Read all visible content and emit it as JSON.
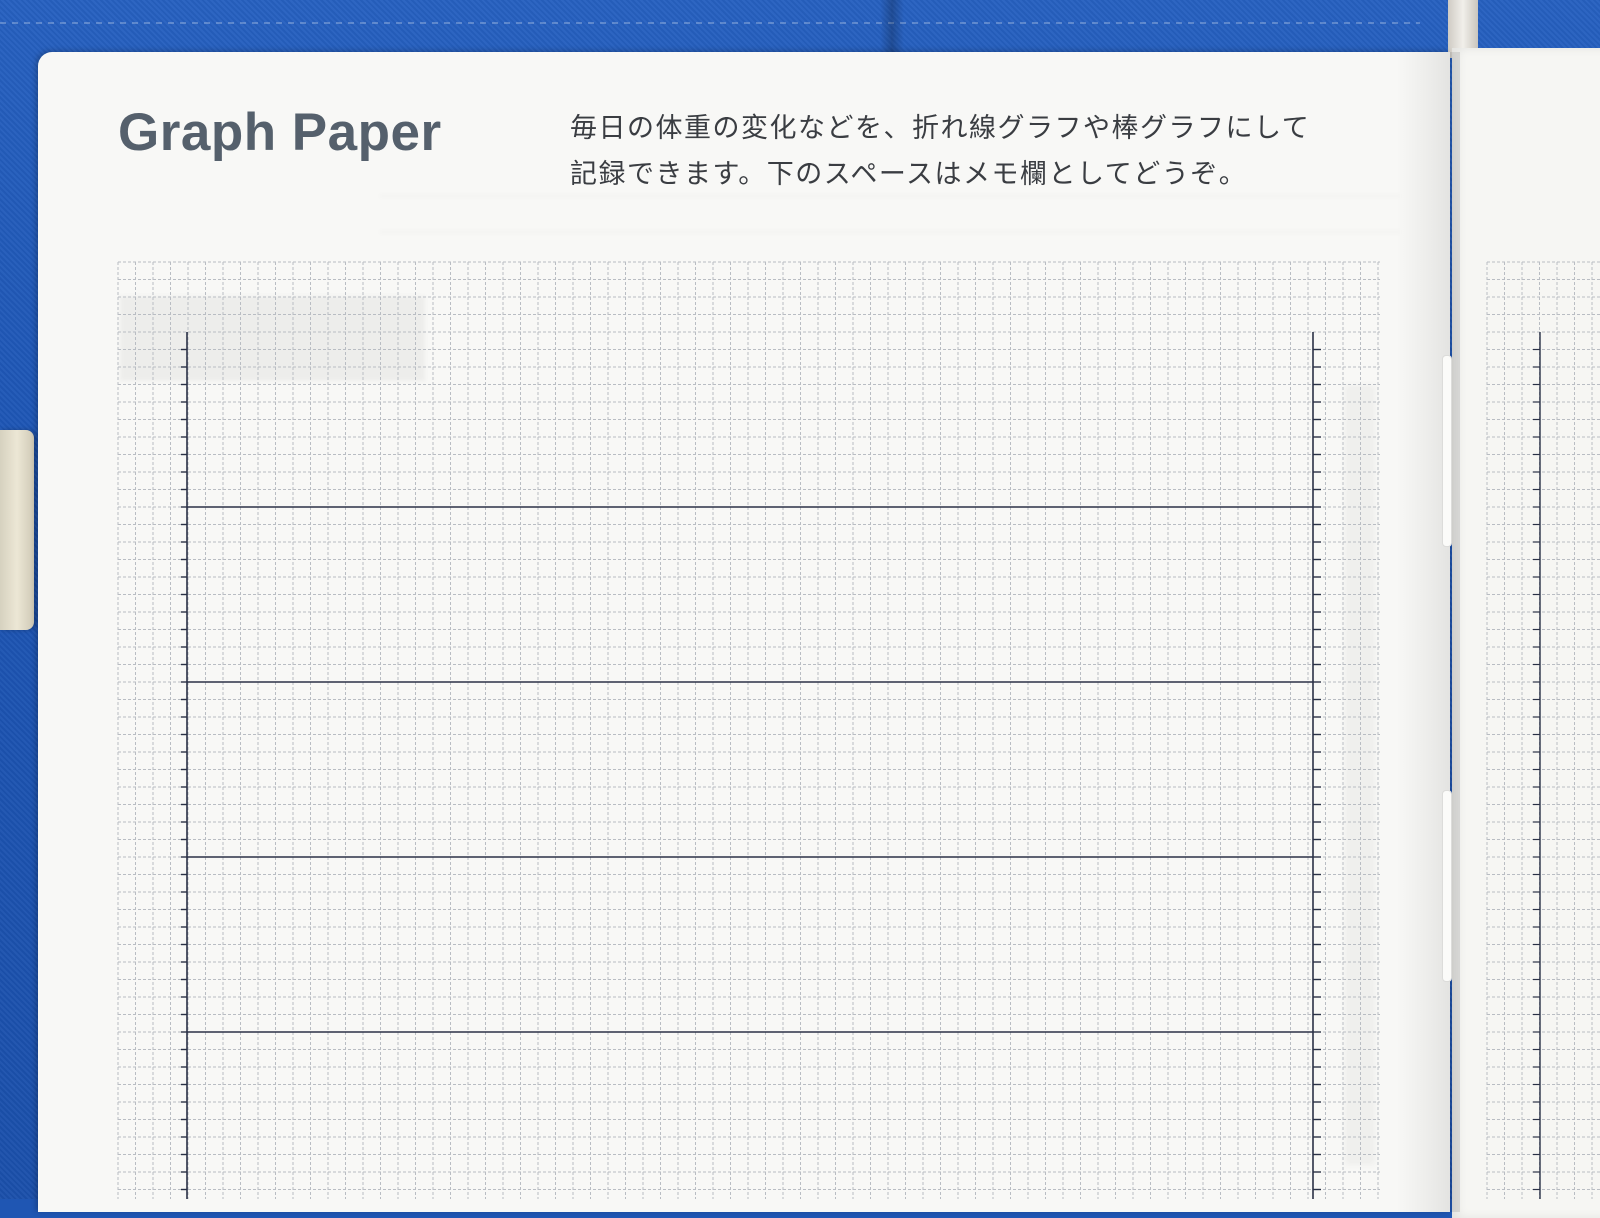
{
  "page": {
    "title": "Graph Paper",
    "description_lines": [
      "毎日の体重の変化などを、折れ線グラフや棒グラフにして",
      "記録できます。下のスペースはメモ欄としてどうぞ。"
    ]
  },
  "colors": {
    "cover": "#1f56b3",
    "paper": "#f8f8f6",
    "grid_line": "#b9bdc3",
    "frame_line": "#2a3146",
    "title_text": "#55606c",
    "body_text": "#3a3d42"
  },
  "grid": {
    "style": "dashed square grid",
    "frame_rows": 4
  }
}
